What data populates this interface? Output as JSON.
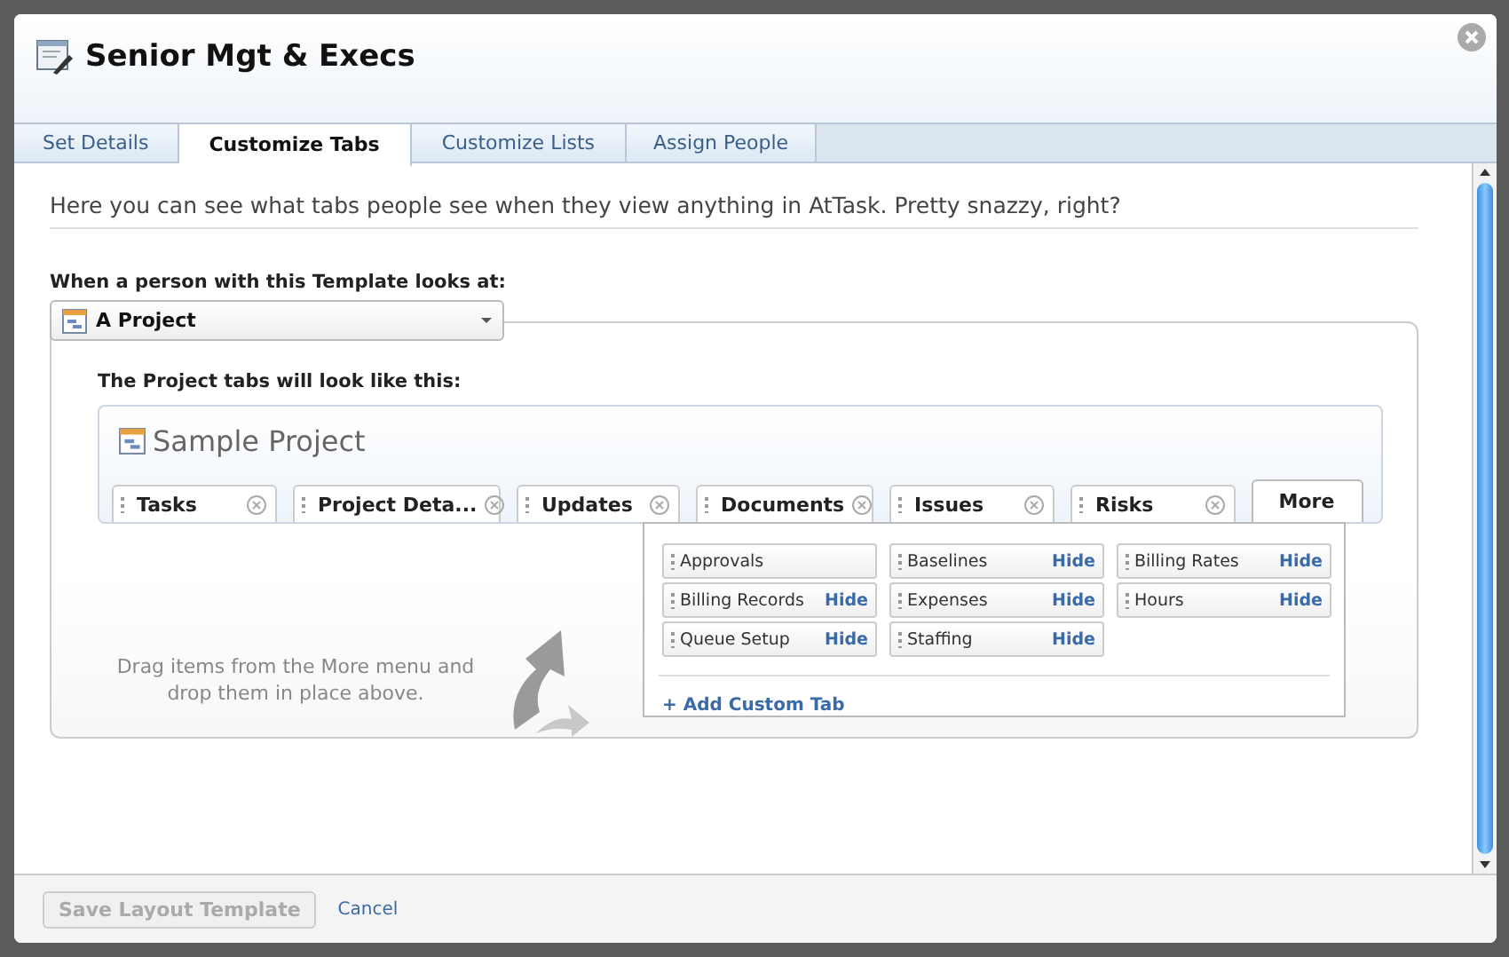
{
  "window": {
    "title": "Senior Mgt & Execs"
  },
  "tabs": [
    {
      "label": "Set Details",
      "selected": false
    },
    {
      "label": "Customize Tabs",
      "selected": true
    },
    {
      "label": "Customize Lists",
      "selected": false
    },
    {
      "label": "Assign People",
      "selected": false
    }
  ],
  "intro": "Here you can see what tabs people see when they view anything in AtTask. Pretty snazzy, right?",
  "object_select": {
    "label": "When a person with this Template looks at:",
    "value": "A Project"
  },
  "preview": {
    "heading": "The Project tabs will look like this:",
    "title": "Sample Project",
    "tabs": [
      {
        "label": "Tasks"
      },
      {
        "label": "Project Deta..."
      },
      {
        "label": "Updates"
      },
      {
        "label": "Documents"
      },
      {
        "label": "Issues"
      },
      {
        "label": "Risks"
      }
    ],
    "more_tab": "More"
  },
  "drag_hint": "Drag items from the More menu and drop them in place above.",
  "more_menu": {
    "items": [
      {
        "label": "Approvals"
      },
      {
        "label": "Baselines",
        "action": "Hide"
      },
      {
        "label": "Billing Rates",
        "action": "Hide"
      },
      {
        "label": "Billing Records",
        "action": "Hide"
      },
      {
        "label": "Expenses",
        "action": "Hide"
      },
      {
        "label": "Hours",
        "action": "Hide"
      },
      {
        "label": "Queue Setup",
        "action": "Hide"
      },
      {
        "label": "Staffing",
        "action": "Hide"
      }
    ],
    "add_link": "+ Add Custom Tab"
  },
  "footer": {
    "save": {
      "label": "Save Layout Template",
      "disabled": true
    },
    "cancel": "Cancel"
  }
}
